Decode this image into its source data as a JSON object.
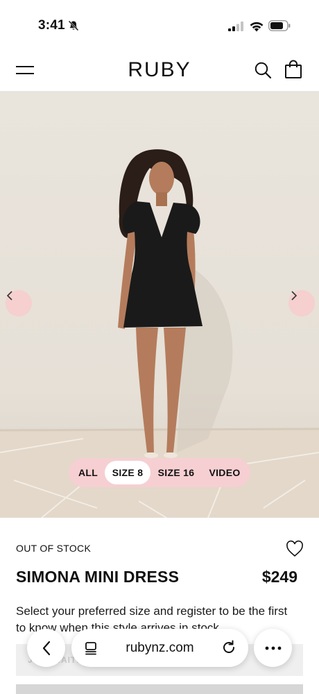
{
  "status_bar": {
    "time": "3:41",
    "icons": [
      "bell-slash-icon",
      "cellular-signal-icon",
      "wifi-icon",
      "battery-icon"
    ]
  },
  "header": {
    "brand": "RUBY",
    "icons": [
      "hamburger-menu-icon",
      "search-icon",
      "shopping-bag-icon"
    ]
  },
  "gallery": {
    "tabs": [
      {
        "label": "ALL",
        "active": false
      },
      {
        "label": "SIZE 8",
        "active": true
      },
      {
        "label": "SIZE 16",
        "active": false
      },
      {
        "label": "VIDEO",
        "active": false
      }
    ],
    "nav_icons": [
      "chevron-left-icon",
      "chevron-right-icon"
    ],
    "accent_color": "#f6cfd2"
  },
  "product": {
    "stock_status": "OUT OF STOCK",
    "name": "SIMONA MINI DRESS",
    "price": "$249",
    "description": "Select your preferred size and register to be the first to know when this style arrives in stock.",
    "waitlist_label": "JOIN WAITLIST"
  },
  "browser": {
    "url": "rubynz.com",
    "icons": [
      "back-chevron-icon",
      "page-menu-icon",
      "reload-icon",
      "more-dots-icon"
    ]
  }
}
